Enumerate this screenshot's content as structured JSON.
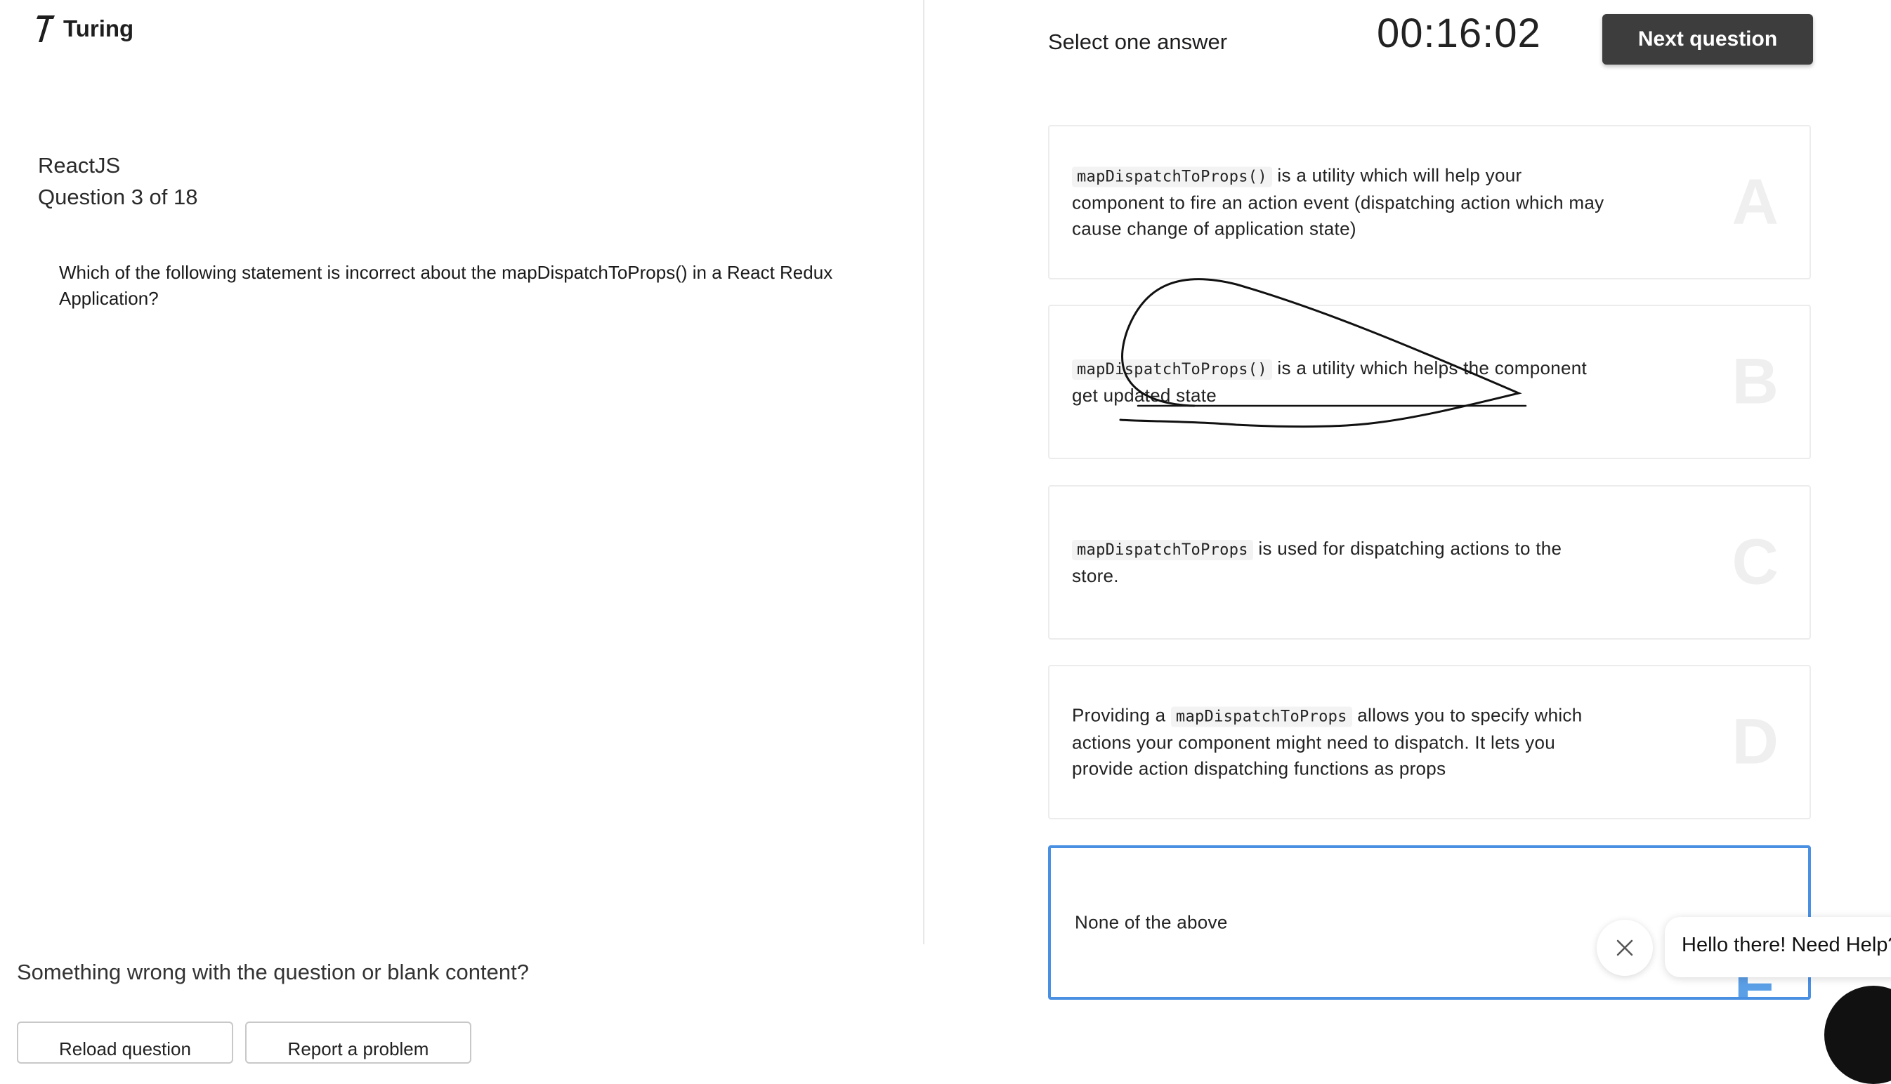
{
  "brand": {
    "name": "Turing"
  },
  "question": {
    "topic": "ReactJS",
    "progress": "Question 3 of 18",
    "text": "Which of the following statement is incorrect about the mapDispatchToProps() in a React Redux Application?"
  },
  "report": {
    "prompt": "Something wrong with the question or blank content?",
    "button1": "Reload question",
    "button2": "Report a problem"
  },
  "header": {
    "select_hint": "Select one answer",
    "timer": "00:16:02",
    "next_button": "Next question"
  },
  "options": [
    {
      "letter": "A",
      "code": "mapDispatchToProps()",
      "text": " is a utility which will help your component to fire an action event (dispatching action which may cause change of application state)"
    },
    {
      "letter": "B",
      "code": "mapDispatchToProps()",
      "text": " is a utility which helps the component get updated state"
    },
    {
      "letter": "C",
      "code": "mapDispatchToProps",
      "text": " is used for dispatching actions to the store."
    },
    {
      "letter": "D",
      "prefix": "Providing a ",
      "code": "mapDispatchToProps",
      "text": " allows you to specify which actions your component might need to dispatch. It lets you provide action dispatching functions as props"
    },
    {
      "letter": "E",
      "text": "None of the above",
      "selected": true
    }
  ],
  "chat": {
    "greeting": "Hello there! Need Help?"
  },
  "colors": {
    "accent": "#4a90e2",
    "button_dark": "#3d3d3d"
  },
  "icons": {
    "logo": "turing-logo-icon",
    "close": "close-icon",
    "chat": "chat-launcher-icon"
  }
}
